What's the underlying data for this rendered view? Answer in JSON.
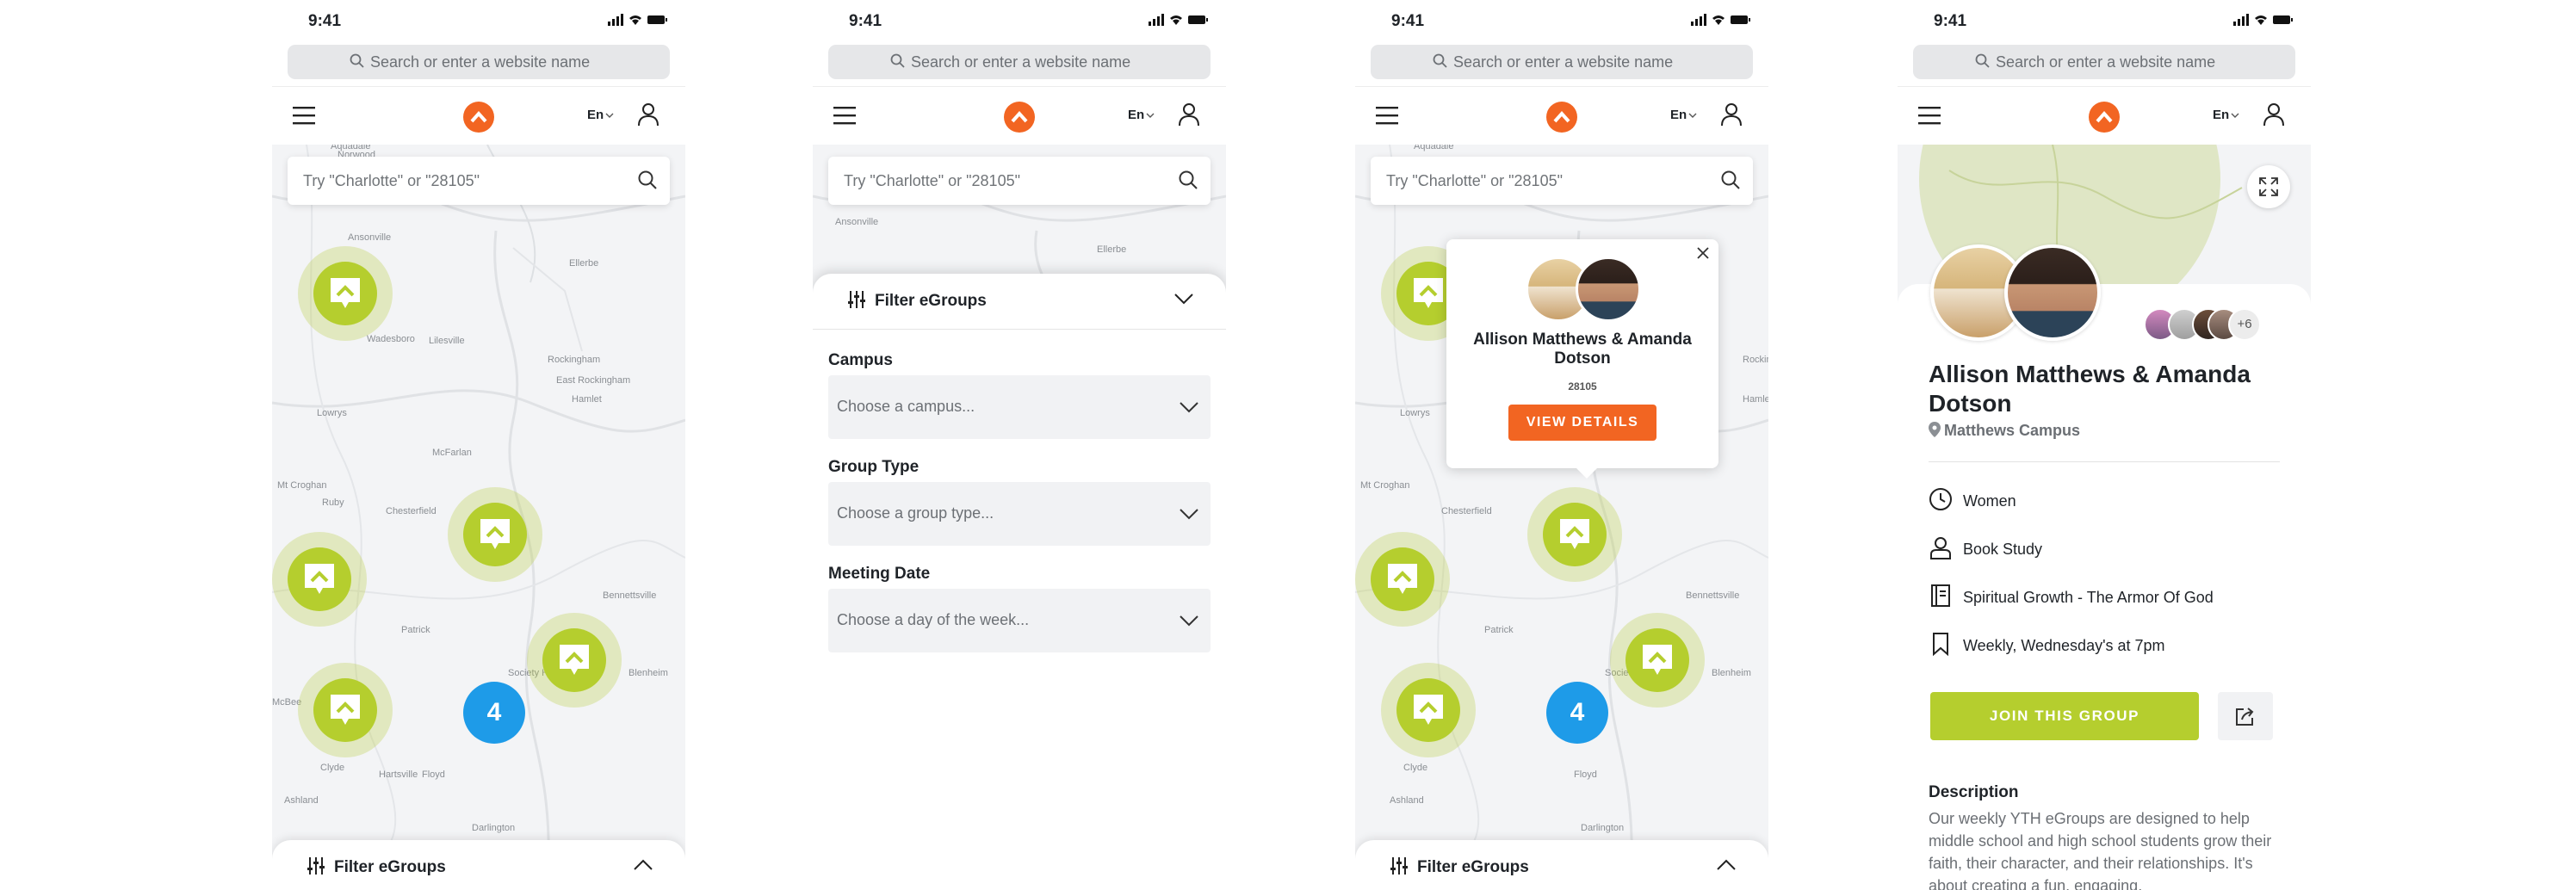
{
  "status": {
    "time": "9:41"
  },
  "browser": {
    "placeholder": "Search or enter a website name"
  },
  "nav": {
    "language": "En"
  },
  "map_search": {
    "placeholder": "Try \"Charlotte\" or \"28105\""
  },
  "map": {
    "cluster_count": "4",
    "labels": [
      "Aquadale",
      "Norwood",
      "Ansonville",
      "Ellerbe",
      "Wadesboro",
      "Lilesville",
      "Rockingham",
      "East Rockingham",
      "Hamlet",
      "Lowrys",
      "McFarlan",
      "Mt Croghan",
      "Ruby",
      "Chesterfield",
      "Patrick",
      "Bennettsville",
      "McBee",
      "Society Hill",
      "Blenheim",
      "Clyde",
      "Hartsville",
      "Floyd",
      "Darlington",
      "Ashland"
    ]
  },
  "filter_bar": {
    "title": "Filter eGroups"
  },
  "filter_panel": {
    "title": "Filter eGroups",
    "campus": {
      "label": "Campus",
      "placeholder": "Choose a campus..."
    },
    "group_type": {
      "label": "Group Type",
      "placeholder": "Choose a group type..."
    },
    "meeting_date": {
      "label": "Meeting Date",
      "placeholder": "Choose a day of the week..."
    }
  },
  "popup": {
    "name": "Allison Matthews & Amanda Dotson",
    "zip": "28105",
    "button": "VIEW DETAILS"
  },
  "detail": {
    "name": "Allison Matthews & Amanda Dotson",
    "campus": "Matthews Campus",
    "more_members": "+6",
    "attributes": [
      {
        "icon": "clock-icon",
        "text": "Women"
      },
      {
        "icon": "person-icon",
        "text": "Book Study"
      },
      {
        "icon": "book-icon",
        "text": "Spiritual Growth - The Armor Of God"
      },
      {
        "icon": "bookmark-icon",
        "text": "Weekly, Wednesday's at 7pm"
      }
    ],
    "join_button": "JOIN THIS GROUP",
    "description_heading": "Description",
    "description": "Our weekly YTH eGroups are designed to help middle school and high school students grow their faith, their character, and their relationships. It's about creating a fun, engaging,"
  },
  "colors": {
    "brand_orange": "#f26522",
    "pin_green": "#b5ce2e",
    "cluster_blue": "#1e9be8"
  }
}
